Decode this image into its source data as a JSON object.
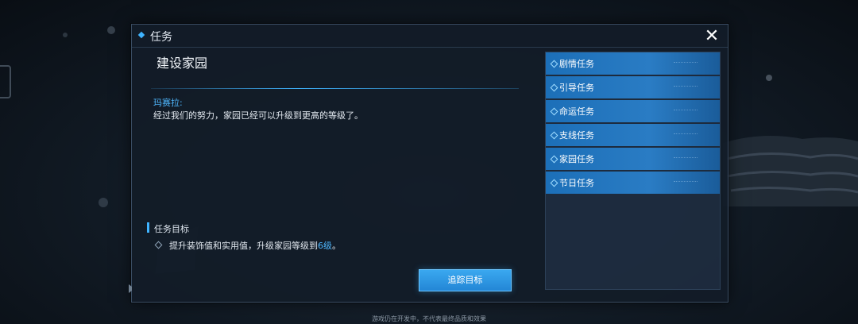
{
  "window": {
    "title": "任务",
    "close_symbol": "✕"
  },
  "quest": {
    "title": "建设家园",
    "speaker": "玛赛拉:",
    "dialogue": "经过我们的努力，家园已经可以升级到更高的等级了。"
  },
  "objective": {
    "heading": "任务目标",
    "text_before": "提升装饰值和实用值，升级家园等级到",
    "highlight": "6级",
    "text_after": "。"
  },
  "track_button": {
    "label": "追踪目标"
  },
  "categories": [
    {
      "label": "剧情任务"
    },
    {
      "label": "引导任务"
    },
    {
      "label": "命运任务"
    },
    {
      "label": "支线任务"
    },
    {
      "label": "家园任务"
    },
    {
      "label": "节日任务"
    }
  ],
  "footer": {
    "note": "游戏仍在开发中，不代表最终品质和效果"
  },
  "colors": {
    "accent": "#3fb4ff",
    "tab": "#2a7cc4",
    "panel": "#121c28"
  }
}
